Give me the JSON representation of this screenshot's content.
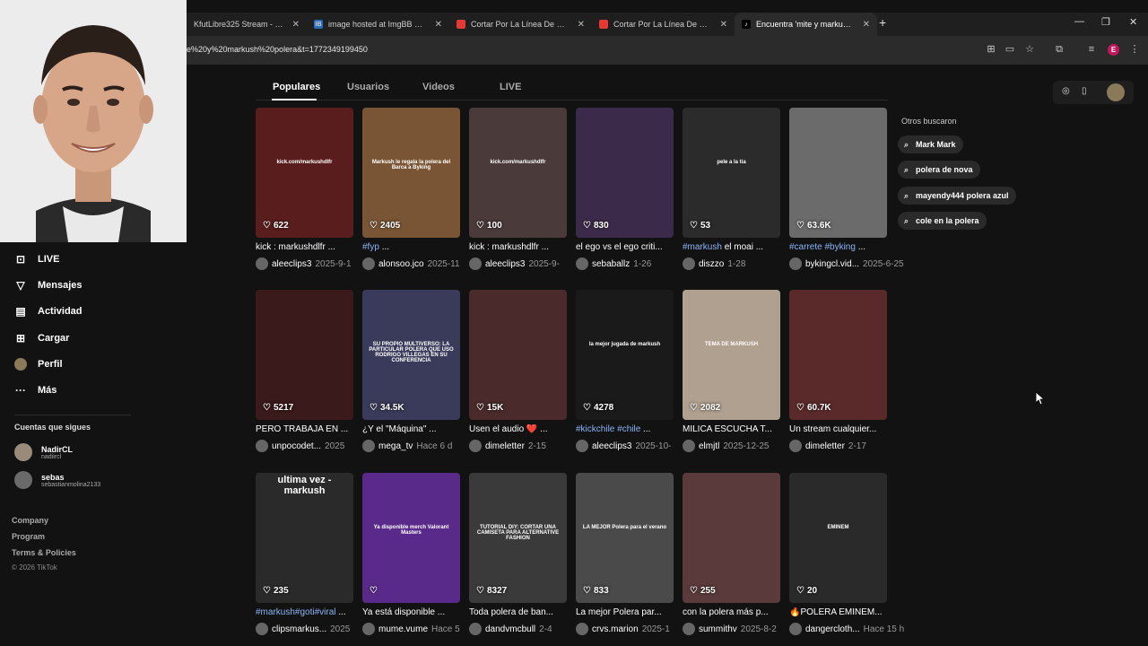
{
  "browser": {
    "tabs": [
      {
        "label": "KfutLibre325 Stream - Kick Das",
        "favicon_color": "#53fc18",
        "favicon_text": ""
      },
      {
        "label": "image hosted at ImgBB — Imgb",
        "favicon_color": "#2a6ebb",
        "favicon_text": "IB"
      },
      {
        "label": "Cortar Por La Línea De Puntos -",
        "favicon_color": "#e53935",
        "favicon_text": ""
      },
      {
        "label": "Cortar Por La Línea De Puntos",
        "favicon_color": "#e53935",
        "favicon_text": ""
      },
      {
        "label": "Encuentra 'mite y markush pol",
        "favicon_color": "#000000",
        "favicon_text": "♪"
      }
    ],
    "new_tab": "+",
    "url": "e%20y%20markush%20polera&t=1772349199450",
    "profile_initial": "E"
  },
  "sidebar": {
    "items": [
      {
        "label": "LIVE",
        "icon": "live-icon"
      },
      {
        "label": "Mensajes",
        "icon": "messages-icon"
      },
      {
        "label": "Actividad",
        "icon": "activity-icon"
      },
      {
        "label": "Cargar",
        "icon": "upload-icon"
      },
      {
        "label": "Perfil",
        "icon": "profile-icon"
      },
      {
        "label": "Más",
        "icon": "more-icon"
      }
    ],
    "following_title": "Cuentas que sigues",
    "following": [
      {
        "name": "NadirCL",
        "username": "nadiircl"
      },
      {
        "name": "sebas",
        "username": "sebastianmolina2133"
      }
    ],
    "footer": [
      "Company",
      "Program",
      "Terms & Policies"
    ],
    "copyright": "© 2026 TikTok"
  },
  "search_tabs": [
    "Populares",
    "Usuarios",
    "Videos",
    "LIVE"
  ],
  "others_title": "Otros buscaron",
  "others": [
    "Mark Mark",
    "polera de nova",
    "mayendy444 polera azul",
    "cole en la polera"
  ],
  "videos": [
    {
      "likes": "622",
      "desc": "kick : markushdlfr ...",
      "tag": "",
      "author": "aleeclips3",
      "date": "2025-9-1",
      "bg": "#5a1d1d",
      "overlay": "kick.com/markushdlfr"
    },
    {
      "likes": "2405",
      "desc": "...",
      "tag": "#fyp",
      "author": "alonsoo.jco",
      "date": "2025-11",
      "bg": "#7a5535",
      "overlay": "Markush le regala la polera del Barca a Byking"
    },
    {
      "likes": "100",
      "desc": "kick : markushdlfr ...",
      "tag": "",
      "author": "aleeclips3",
      "date": "2025-9-",
      "bg": "#4b3a3a",
      "overlay": "kick.com/markushdlfr"
    },
    {
      "likes": "830",
      "desc": "el ego vs el ego criti...",
      "tag": "",
      "author": "sebaballz",
      "date": "1-26",
      "bg": "#3c2a4a",
      "overlay": ""
    },
    {
      "likes": "53",
      "desc": "el moai ...",
      "tag": "#markush",
      "author": "diszzo",
      "date": "1-28",
      "bg": "#2b2b2b",
      "overlay": "pele a la tia"
    },
    {
      "likes": "63.6K",
      "desc": "...",
      "tag": "#carrete #byking",
      "author": "bykingcl.vid...",
      "date": "2025-6-25",
      "bg": "#6b6b6b",
      "overlay": ""
    },
    {
      "likes": "5217",
      "desc": "PERO TRABAJA EN ...",
      "tag": "",
      "author": "unpocodet...",
      "date": "2025",
      "bg": "#3a1a1a",
      "overlay": ""
    },
    {
      "likes": "34.5K",
      "desc": "¿Y el \"Máquina\" ...",
      "tag": "",
      "author": "mega_tv",
      "date": "Hace 6 d",
      "bg": "#3a3a5a",
      "overlay": "SU PROPIO MULTIVERSO: LA PARTICULAR POLERA QUE USO RODRIGO VILLEGAS EN SU CONFERENCIA"
    },
    {
      "likes": "15K",
      "desc": "Usen el audio ❤️ ...",
      "tag": "",
      "author": "dimeletter",
      "date": "2-15",
      "bg": "#4a2a2a",
      "overlay": ""
    },
    {
      "likes": "4278",
      "desc": "...",
      "tag": "#kickchile #chile",
      "author": "aleeclips3",
      "date": "2025-10-",
      "bg": "#1a1a1a",
      "overlay": "la mejor jugada de markush"
    },
    {
      "likes": "2082",
      "desc": "MILICA ESCUCHA T...",
      "tag": "",
      "author": "elmjtl",
      "date": "2025-12-25",
      "bg": "#b0a090",
      "overlay": "TEMA DE MARKUSH"
    },
    {
      "likes": "60.7K",
      "desc": "Un stream cualquier...",
      "tag": "",
      "author": "dimeletter",
      "date": "2-17",
      "bg": "#5a2a2a",
      "overlay": ""
    },
    {
      "likes": "235",
      "desc": "...",
      "tag": "#markush#goti#viral",
      "author": "clipsmarkus...",
      "date": "2025",
      "bg": "#2a2a2a",
      "overlay": "ultima vez - markush"
    },
    {
      "likes": "",
      "desc": "Ya está disponible ...",
      "tag": "",
      "author": "mume.vume",
      "date": "Hace 5",
      "bg": "#5a2a8a",
      "overlay": "Ya disponible merch Valorant Masters"
    },
    {
      "likes": "8327",
      "desc": "Toda polera de ban...",
      "tag": "",
      "author": "dandvmcbull",
      "date": "2-4",
      "bg": "#3a3a3a",
      "overlay": "TUTORIAL DIY: CORTAR UNA CAMISETA PARA ALTERNATIVE FASHION"
    },
    {
      "likes": "833",
      "desc": "La mejor Polera par...",
      "tag": "",
      "author": "crvs.marion",
      "date": "2025-1",
      "bg": "#4a4a4a",
      "overlay": "LA MEJOR Polera para el verano"
    },
    {
      "likes": "255",
      "desc": "con la polera más p...",
      "tag": "",
      "author": "summithv",
      "date": "2025-8-2",
      "bg": "#5a3a3a",
      "overlay": ""
    },
    {
      "likes": "20",
      "desc": "🔥POLERA EMINEM...",
      "tag": "",
      "author": "dangercloth...",
      "date": "Hace 15 h",
      "bg": "#2a2a2a",
      "overlay": "EMINEM"
    }
  ]
}
